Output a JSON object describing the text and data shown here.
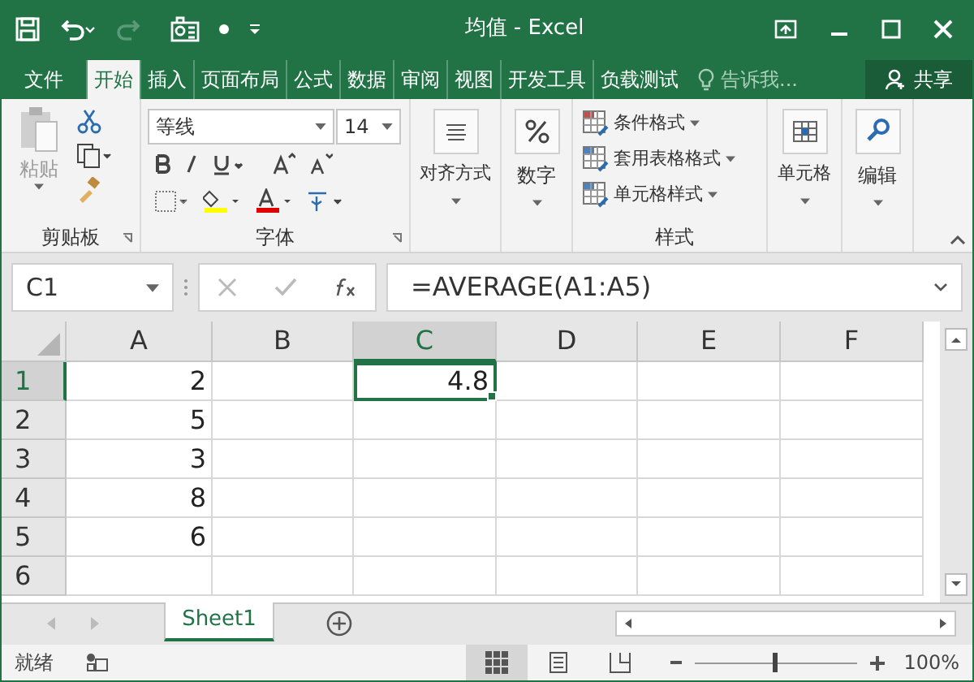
{
  "title_bar": {
    "title": "均值 - Excel"
  },
  "ribbon_tabs": [
    {
      "label": "文件",
      "selected": false
    },
    {
      "label": "开始",
      "selected": true
    },
    {
      "label": "插入",
      "selected": false
    },
    {
      "label": "页面布局",
      "selected": false
    },
    {
      "label": "公式",
      "selected": false
    },
    {
      "label": "数据",
      "selected": false
    },
    {
      "label": "审阅",
      "selected": false
    },
    {
      "label": "视图",
      "selected": false
    },
    {
      "label": "开发工具",
      "selected": false
    },
    {
      "label": "负载测试",
      "selected": false
    }
  ],
  "tell_me": {
    "placeholder": "告诉我..."
  },
  "share_button": "共享",
  "ribbon": {
    "clipboard": {
      "paste": "粘贴",
      "group_label": "剪贴板"
    },
    "font": {
      "font_name": "等线",
      "font_size": "14",
      "group_label": "字体"
    },
    "alignment": "对齐方式",
    "number": "数字",
    "styles": {
      "items": [
        "条件格式",
        "套用表格格式",
        "单元格样式"
      ],
      "group_label": "样式"
    },
    "cells": "单元格",
    "editing": "编辑"
  },
  "formula_bar": {
    "name_box": "C1",
    "formula": "=AVERAGE(A1:A5)"
  },
  "grid": {
    "columns": [
      {
        "label": "A",
        "selected": false
      },
      {
        "label": "B",
        "selected": false
      },
      {
        "label": "C",
        "selected": true
      },
      {
        "label": "D",
        "selected": false
      },
      {
        "label": "E",
        "selected": false
      },
      {
        "label": "F",
        "selected": false
      }
    ],
    "rows": [
      {
        "label": "1",
        "selected": true,
        "cells": [
          "2",
          null,
          "4.8",
          null,
          null,
          null
        ]
      },
      {
        "label": "2",
        "selected": false,
        "cells": [
          "5",
          null,
          null,
          null,
          null,
          null
        ]
      },
      {
        "label": "3",
        "selected": false,
        "cells": [
          "3",
          null,
          null,
          null,
          null,
          null
        ]
      },
      {
        "label": "4",
        "selected": false,
        "cells": [
          "8",
          null,
          null,
          null,
          null,
          null
        ]
      },
      {
        "label": "5",
        "selected": false,
        "cells": [
          "6",
          null,
          null,
          null,
          null,
          null
        ]
      },
      {
        "label": "6",
        "selected": false,
        "cells": [
          null,
          null,
          null,
          null,
          null,
          null
        ]
      }
    ]
  },
  "sheet_tabs": [
    {
      "label": "Sheet1",
      "selected": true
    }
  ],
  "status_bar": {
    "status": "就绪",
    "view_modes": [
      {
        "kind": "normal",
        "selected": true
      },
      {
        "kind": "layout",
        "selected": false
      },
      {
        "kind": "break",
        "selected": false
      }
    ],
    "zoom": {
      "level": 0.5,
      "reading": "100%"
    }
  }
}
